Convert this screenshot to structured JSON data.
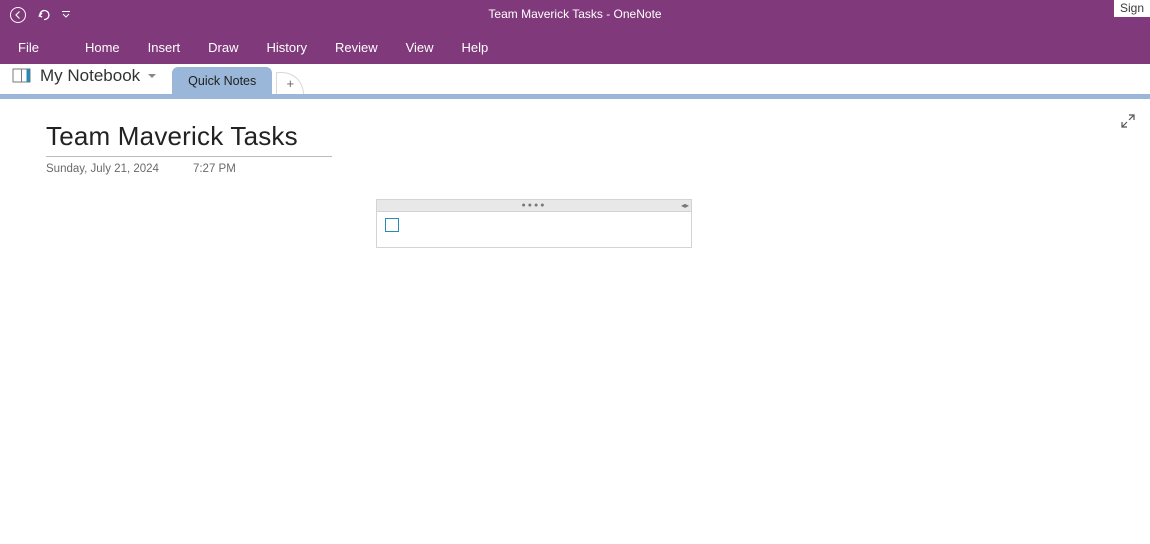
{
  "app": {
    "title": "Team Maverick Tasks  -  OneNote",
    "sign_in_label": "Sign"
  },
  "menu": {
    "file": "File",
    "home": "Home",
    "insert": "Insert",
    "draw": "Draw",
    "history": "History",
    "review": "Review",
    "view": "View",
    "help": "Help"
  },
  "notebook": {
    "name": "My Notebook"
  },
  "section_tab": {
    "label": "Quick Notes",
    "add_symbol": "+"
  },
  "page": {
    "title": "Team Maverick Tasks",
    "date": "Sunday, July 21, 2024",
    "time": "7:27 PM"
  }
}
